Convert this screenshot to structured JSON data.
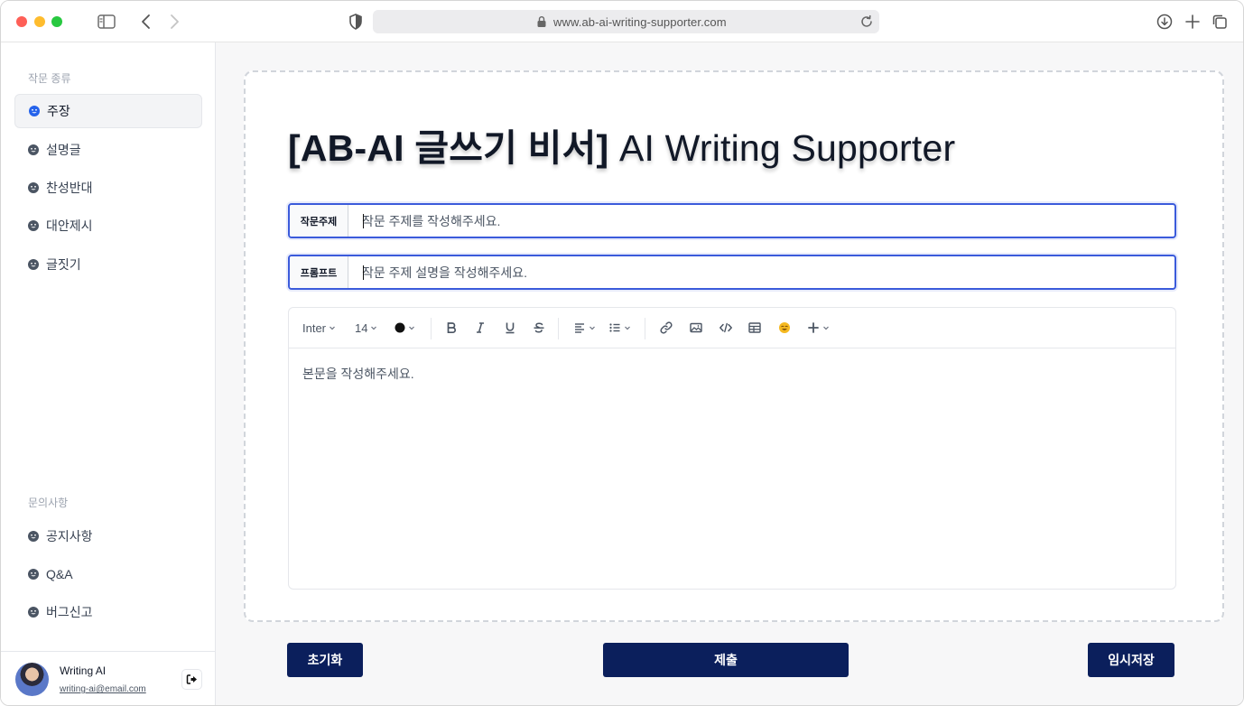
{
  "browser": {
    "url": "www.ab-ai-writing-supporter.com"
  },
  "sidebar": {
    "section1_label": "작문 종류",
    "items": [
      {
        "label": "주장",
        "active": true
      },
      {
        "label": "설명글",
        "active": false
      },
      {
        "label": "찬성반대",
        "active": false
      },
      {
        "label": "대안제시",
        "active": false
      },
      {
        "label": "글짓기",
        "active": false
      }
    ],
    "section2_label": "문의사항",
    "support_items": [
      {
        "label": "공지사항"
      },
      {
        "label": "Q&A"
      },
      {
        "label": "버그신고"
      }
    ],
    "profile": {
      "name": "Writing AI",
      "email": "writing-ai@email.com"
    }
  },
  "main": {
    "title_bold": "[AB-AI 글쓰기 비서]",
    "title_light": "AI Writing Supporter",
    "topic": {
      "label": "작문주제",
      "placeholder": "작문 주제를 작성해주세요."
    },
    "prompt": {
      "label": "프롬프트",
      "placeholder": "작문 주제 설명을 작성해주세요."
    },
    "editor": {
      "font": "Inter",
      "font_size": "14",
      "text_color": "#111111",
      "placeholder": "본문을 작성해주세요."
    },
    "buttons": {
      "reset": "초기화",
      "submit": "제출",
      "save_draft": "임시저장"
    }
  },
  "colors": {
    "accent": "#0b1f5c",
    "focus_border": "#3b5bdb",
    "active_dot": "#2563eb"
  }
}
